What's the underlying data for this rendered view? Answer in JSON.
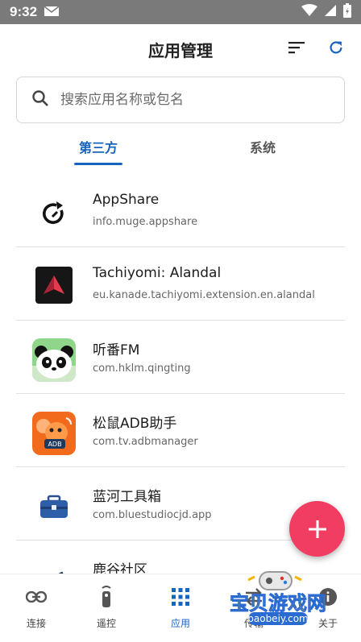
{
  "status_bar": {
    "time": "9:32"
  },
  "app_bar": {
    "title": "应用管理"
  },
  "search": {
    "placeholder": "搜索应用名称或包名"
  },
  "tabs": [
    {
      "label": "第三方"
    },
    {
      "label": "系统"
    }
  ],
  "apps": [
    {
      "name": "AppShare",
      "package": "info.muge.appshare",
      "icon": "appshare-icon"
    },
    {
      "name": "Tachiyomi: Alandal",
      "package": "eu.kanade.tachiyomi.extension.en.alandal",
      "icon": "tachiyomi-icon"
    },
    {
      "name": "听番FM",
      "package": "com.hklm.qingting",
      "icon": "panda-icon"
    },
    {
      "name": "松鼠ADB助手",
      "package": "com.tv.adbmanager",
      "icon": "squirrel-adb-icon"
    },
    {
      "name": "蓝河工具箱",
      "package": "com.bluestudiocjd.app",
      "icon": "toolbox-icon"
    },
    {
      "name": "鹿谷社区",
      "package": "",
      "icon": "lugu-icon"
    }
  ],
  "bottom_nav": [
    {
      "label": "连接",
      "icon": "link-icon"
    },
    {
      "label": "遥控",
      "icon": "remote-icon"
    },
    {
      "label": "应用",
      "icon": "apps-grid-icon"
    },
    {
      "label": "传输",
      "icon": "transfer-icon"
    },
    {
      "label": "关于",
      "icon": "info-icon"
    }
  ],
  "watermark": {
    "text": "宝贝游戏网",
    "url_text": "baobeiy.com"
  },
  "colors": {
    "accent": "#1565c0",
    "fab": "#f23d63",
    "statusbar": "#7a7a7a"
  }
}
